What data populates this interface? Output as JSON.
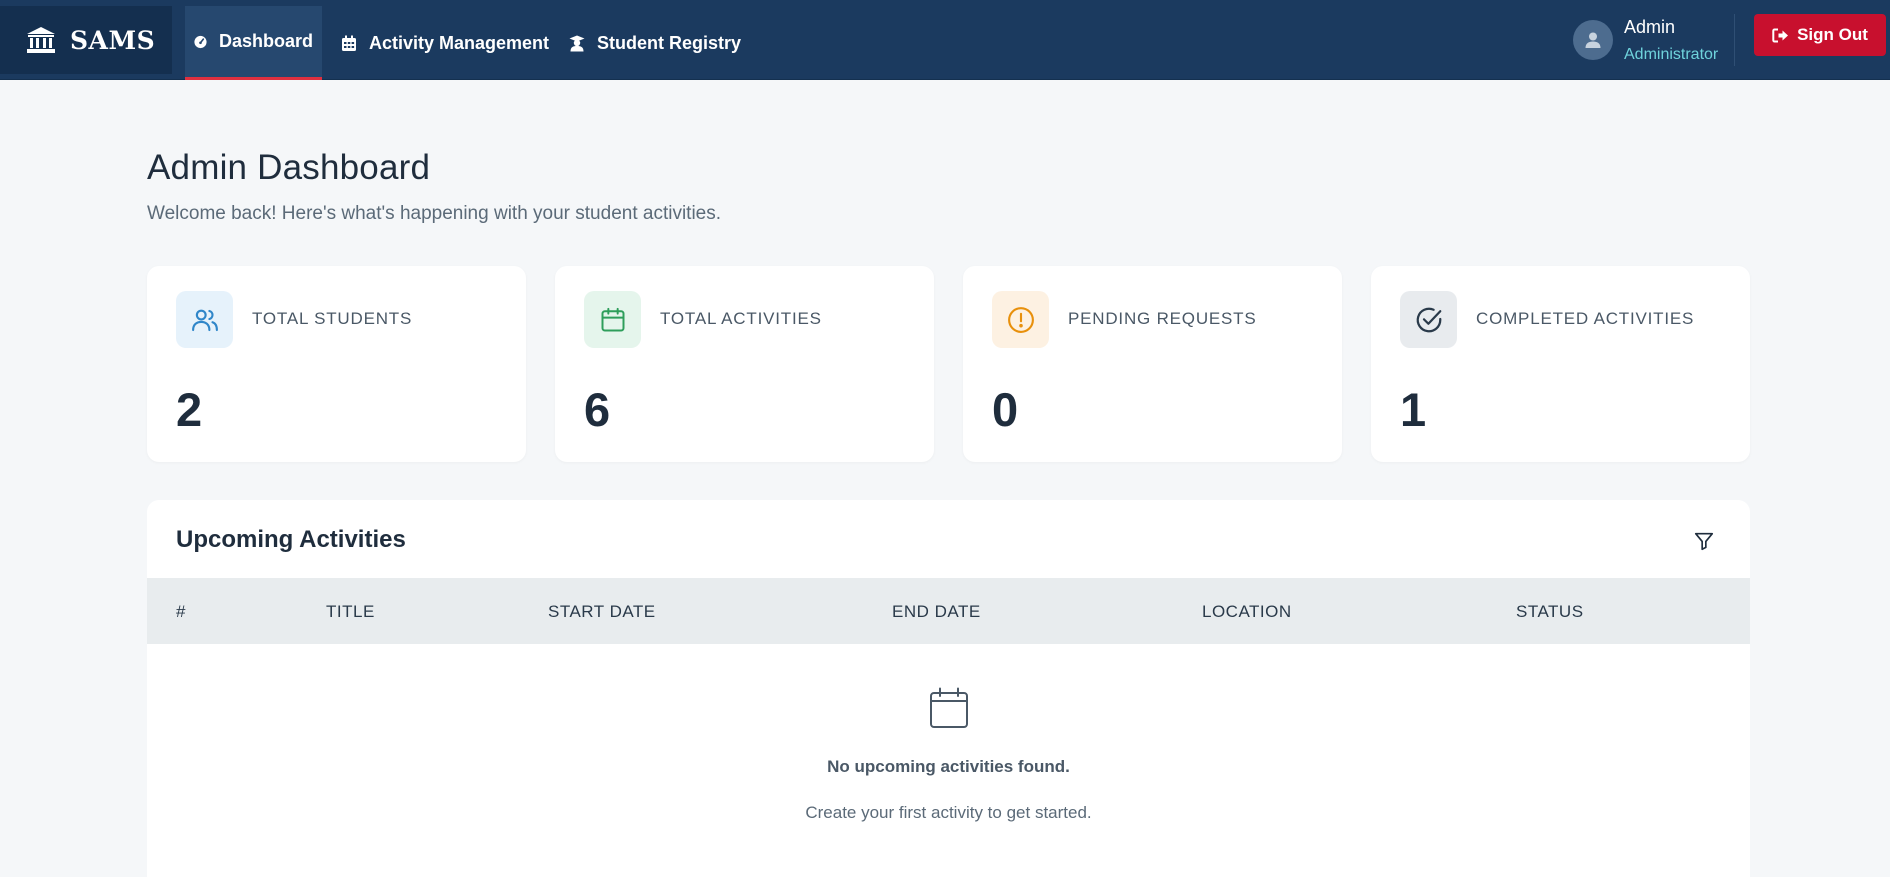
{
  "brand": {
    "name": "SAMS"
  },
  "nav": {
    "dashboard": "Dashboard",
    "activities": "Activity Management",
    "registry": "Student Registry"
  },
  "user": {
    "name": "Admin",
    "role": "Administrator",
    "sign_out": "Sign Out"
  },
  "header": {
    "title": "Admin Dashboard",
    "subtitle": "Welcome back! Here's what's happening with your student activities."
  },
  "stats": [
    {
      "label": "TOTAL STUDENTS",
      "value": "2",
      "icon": "users-icon",
      "color": "#2f86c9"
    },
    {
      "label": "TOTAL ACTIVITIES",
      "value": "6",
      "icon": "calendar-icon",
      "color": "#2e9e5b"
    },
    {
      "label": "PENDING REQUESTS",
      "value": "0",
      "icon": "alert-circle-icon",
      "color": "#e8900c"
    },
    {
      "label": "COMPLETED ACTIVITIES",
      "value": "1",
      "icon": "check-circle-icon",
      "color": "#2a3a4a"
    }
  ],
  "upcoming": {
    "title": "Upcoming Activities",
    "columns": [
      "#",
      "TITLE",
      "START DATE",
      "END DATE",
      "LOCATION",
      "STATUS"
    ],
    "rows": [],
    "empty_title": "No upcoming activities found.",
    "empty_subtitle": "Create your first activity to get started."
  },
  "colors": {
    "navbar": "#1b3a5f",
    "accent_red": "#c8102e",
    "role_teal": "#6fd3dc"
  }
}
